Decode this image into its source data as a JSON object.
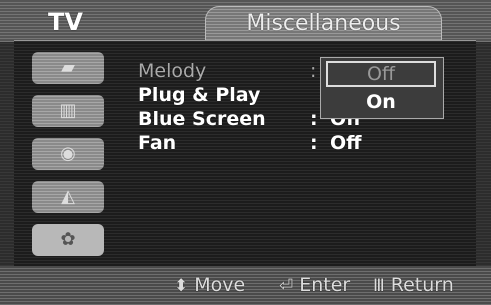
{
  "header": {
    "source_label": "TV",
    "menu_title": "Miscellaneous"
  },
  "sidebar": {
    "items": [
      {
        "icon": "picture-icon",
        "glyph": "▰"
      },
      {
        "icon": "sound-icon",
        "glyph": "▥"
      },
      {
        "icon": "channel-icon",
        "glyph": "◉"
      },
      {
        "icon": "setup-icon",
        "glyph": "◭"
      },
      {
        "icon": "misc-icon",
        "glyph": "✿"
      }
    ],
    "active_index": 4
  },
  "menu": {
    "items": [
      {
        "label": "Melody",
        "value": "",
        "dimmed": true
      },
      {
        "label": "Plug & Play",
        "value": "",
        "dimmed": false
      },
      {
        "label": "Blue Screen",
        "value": "Off",
        "dimmed": false
      },
      {
        "label": "Fan",
        "value": "Off",
        "dimmed": false
      }
    ],
    "colon": ":"
  },
  "dropdown": {
    "options": [
      "Off",
      "On"
    ],
    "highlighted": "Off"
  },
  "footer": {
    "move_label": "Move",
    "enter_label": "Enter",
    "return_label": "Return",
    "move_glyph": "⬍",
    "enter_glyph": "⏎",
    "return_glyph": "Ⅲ"
  }
}
